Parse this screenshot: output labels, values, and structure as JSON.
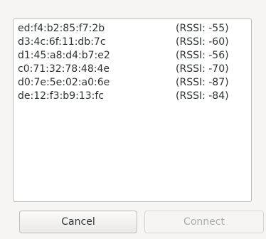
{
  "devices": [
    {
      "mac": "ed:f4:b2:85:f7:2b",
      "rssi": "(RSSI: -55)"
    },
    {
      "mac": "d3:4c:6f:11:db:7c",
      "rssi": "(RSSI: -60)"
    },
    {
      "mac": "d1:45:a8:d4:b7:e2",
      "rssi": "(RSSI: -56)"
    },
    {
      "mac": "c0:71:32:78:48:4e",
      "rssi": "(RSSI: -70)"
    },
    {
      "mac": "d0:7e:5e:02:a0:6e",
      "rssi": "(RSSI: -87)"
    },
    {
      "mac": "de:12:f3:b9:13:fc",
      "rssi": "(RSSI: -84)"
    }
  ],
  "buttons": {
    "cancel_label": "Cancel",
    "connect_label": "Connect",
    "connect_enabled": false
  },
  "colors": {
    "window_bg": "#f6f5f4",
    "list_bg": "#ffffff",
    "text": "#2e3436",
    "disabled_text": "#a9adad"
  }
}
